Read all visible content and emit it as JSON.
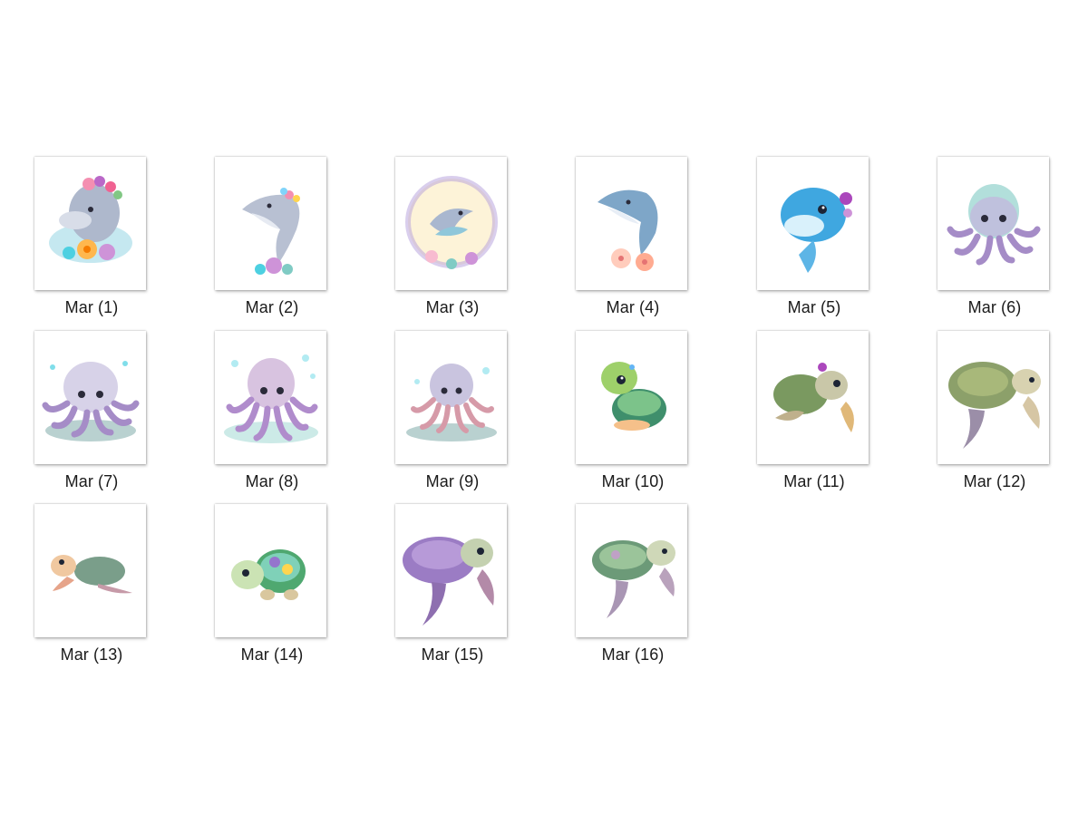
{
  "files": [
    {
      "label": "Mar (1)",
      "subject": "dolphin-flower-crown-illustration"
    },
    {
      "label": "Mar (2)",
      "subject": "dolphin-leaping-illustration"
    },
    {
      "label": "Mar (3)",
      "subject": "dolphin-wreath-illustration"
    },
    {
      "label": "Mar (4)",
      "subject": "dolphin-hibiscus-illustration"
    },
    {
      "label": "Mar (5)",
      "subject": "blue-dolphin-illustration"
    },
    {
      "label": "Mar (6)",
      "subject": "octopus-illustration"
    },
    {
      "label": "Mar (7)",
      "subject": "octopus-coral-illustration"
    },
    {
      "label": "Mar (8)",
      "subject": "octopus-bubbles-illustration"
    },
    {
      "label": "Mar (9)",
      "subject": "octopus-reef-illustration"
    },
    {
      "label": "Mar (10)",
      "subject": "baby-turtle-illustration"
    },
    {
      "label": "Mar (11)",
      "subject": "sea-turtle-flower-illustration"
    },
    {
      "label": "Mar (12)",
      "subject": "sea-turtle-illustration"
    },
    {
      "label": "Mar (13)",
      "subject": "small-turtle-illustration"
    },
    {
      "label": "Mar (14)",
      "subject": "rainbow-turtle-illustration"
    },
    {
      "label": "Mar (15)",
      "subject": "purple-sea-turtle-illustration"
    },
    {
      "label": "Mar (16)",
      "subject": "green-sea-turtle-illustration"
    }
  ]
}
